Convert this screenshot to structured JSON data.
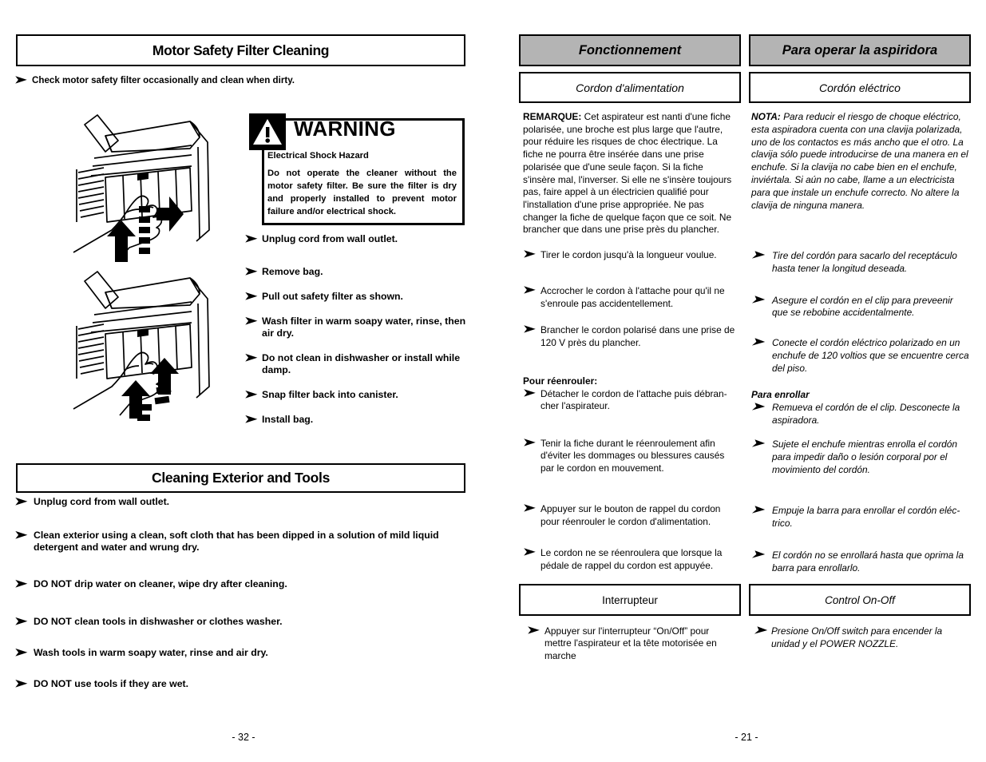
{
  "english": {
    "section1_title": "Motor Safety Filter Cleaning",
    "intro": "Check motor safety filter occasionally and clean when dirty.",
    "warning": {
      "icon": "warning-triangle-icon",
      "word": "WARNING",
      "hazard": "Electrical Shock Hazard",
      "body": "Do not operate the cleaner without the motor safety filter. Be sure the filter is dry and properly installed to prevent motor failure and/or electrical shock."
    },
    "steps": [
      "Unplug cord from wall outlet.",
      "Remove bag.",
      "Pull out safety filter as shown.",
      "Wash filter in warm soapy water, rinse, then air dry.",
      "Do not clean in dishwasher or install while damp.",
      "Snap filter back into canister.",
      "Install bag."
    ],
    "section2_title": "Cleaning Exterior and Tools",
    "steps2": [
      "Unplug cord from wall outlet.",
      "Clean exterior using a clean, soft cloth that has been dipped in a solution of mild liquid detergent and water and wrung dry.",
      "DO NOT drip water on cleaner, wipe dry after cleaning.",
      "DO NOT clean tools in dishwasher or clothes washer.",
      "Wash tools in warm soapy water, rinse and air dry.",
      "DO NOT use tools if they are wet."
    ],
    "page_number": "- 32 -"
  },
  "french": {
    "header": "Fonctionnement",
    "subheader": "Cordon d'alimentation",
    "note_label": "REMARQUE:",
    "note_body": "Cet aspirateur est nanti d'une fiche polarisée,  une broche est plus large que l'autre, pour réduire les risques de choc électrique. La fiche ne pourra être insérée dans une prise polarisée que d'une seule façon. Si la fiche s'insère mal, l'inverser. Si elle ne s'insère toujours pas, faire appel à un électricien qualifié pour l'installation d'une prise appropriée. Ne pas changer la fiche de quelque façon que ce soit.  Ne brancher que dans une prise près du plancher.",
    "bullets1": [
      "Tirer le cordon jusqu'à la longueur voulue.",
      "Accrocher le cordon à l'attache pour qu'il ne s'enroule pas accidentellement.",
      "Brancher le cordon polarisé dans une prise de 120 V près du plancher."
    ],
    "rewind_label": "Pour réenrouler:",
    "bullets2": [
      "Détacher le cordon de l'attache puis débran-cher l'aspirateur."
    ],
    "bullets3": [
      " Tenir la fiche durant le réenroulement afin d'éviter les dommages ou blessures causés par le cordon en mouvement.",
      "Appuyer sur le bouton de rappel du cordon pour réenrouler le cordon d'alimentation.",
      "Le cordon ne se réenroulera que lorsque la pédale de rappel du cordon est appuyée."
    ],
    "switch_header": "Interrupteur",
    "switch_bullet": "Appuyer sur l'interrupteur “On/Off” pour mettre l'aspirateur et la tête motorisée en marche"
  },
  "spanish": {
    "header": "Para operar la aspiridora",
    "subheader": "Cordón eléctrico",
    "note_label": "NOTA:",
    "note_body": "Para reducir el riesgo de choque eléctrico, esta aspiradora cuenta con una clavija polarizada, uno de los contactos es más ancho que el otro. La clavija sólo puede introducirse de una manera en el enchufe. Si la clavija no cabe bien en el enchufe, inviértala. Si aún no cabe, llame a un electricista para que instale un enchufe correcto. No altere la clavija de ninguna manera.",
    "bullets1": [
      "Tire del cordón  para sacarlo del receptáculo hasta tener la longitud deseada.",
      "Asegure el cordón  en el clip para preveenir que se rebobine accidentalmente.",
      "Conecte el  cordón  eléctrico polarizado en un enchufe de 120 voltios que se encuentre cerca del piso."
    ],
    "rewind_label": "Para enrollar",
    "bullets2": [
      "Remueva  el cordón de el clip. Desconecte la aspiradora."
    ],
    "bullets3": [
      "Sujete el enchufe mientras enrolla el cordón para  impedir  daño o lesión corporal por el movimiento del cordón.",
      "Empuje la barra para enrollar el cordón eléc-trico.",
      "El cordón no se enrollará hasta que oprima la barra para enrollarlo."
    ],
    "switch_header": "Control On-Off",
    "switch_bullet": "Presione On/Off  switch para encender la unidad y el POWER NOZZLE.",
    "page_number": "- 21 -"
  },
  "figures": [
    {
      "name": "pull-out-filter-illustration",
      "caption": ""
    },
    {
      "name": "snap-filter-illustration",
      "caption": ""
    }
  ],
  "colors": {
    "header_gray": "#b4b4b4",
    "ink": "#000000",
    "paper": "#ffffff"
  },
  "glyphs": {
    "bullet_arrow": "➤"
  }
}
